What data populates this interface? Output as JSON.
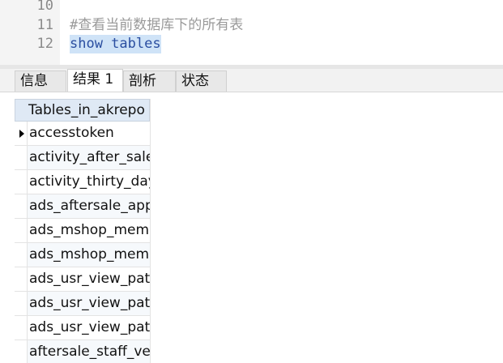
{
  "editor": {
    "lines": [
      {
        "number": "10",
        "code": ""
      },
      {
        "number": "11",
        "code": "#查看当前数据库下的所有表"
      },
      {
        "number": "12",
        "code": "show tables"
      }
    ]
  },
  "tabs": [
    {
      "label": "信息",
      "active": false
    },
    {
      "label": "结果 1",
      "active": true
    },
    {
      "label": "剖析",
      "active": false
    },
    {
      "label": "状态",
      "active": false
    }
  ],
  "results": {
    "column_header": "Tables_in_akrepo",
    "rows": [
      "accesstoken",
      "activity_after_sale",
      "activity_thirty_day",
      "ads_aftersale_app",
      "ads_mshop_mem",
      "ads_mshop_mem",
      "ads_usr_view_pat",
      "ads_usr_view_pat",
      "ads_usr_view_pat",
      "aftersale_staff_ver"
    ],
    "current_row_index": 0
  },
  "colors": {
    "selection_bg": "#cfe3f7",
    "selection_text": "#2a4ea0",
    "comment": "#9a9a9a",
    "header_bg": "#dfe9f5"
  }
}
